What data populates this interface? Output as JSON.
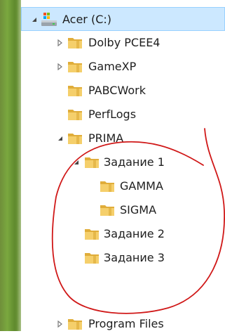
{
  "tree": {
    "drive": {
      "label": "Acer (C:)",
      "icon": "drive-icon",
      "expanded": true,
      "selected": true
    },
    "items": [
      {
        "label": "Dolby PCEE4",
        "icon": "folder-icon",
        "expander": "collapsed"
      },
      {
        "label": "GameXP",
        "icon": "folder-icon",
        "expander": "collapsed"
      },
      {
        "label": "PABCWork",
        "icon": "folder-icon",
        "expander": "none"
      },
      {
        "label": "PerfLogs",
        "icon": "folder-icon",
        "expander": "none"
      },
      {
        "label": "PRIMA",
        "icon": "folder-icon",
        "expander": "expanded"
      },
      {
        "label": "Задание 1",
        "icon": "folder-icon",
        "expander": "expanded"
      },
      {
        "label": "GAMMA",
        "icon": "folder-icon",
        "expander": "none"
      },
      {
        "label": "SIGMA",
        "icon": "folder-icon",
        "expander": "none"
      },
      {
        "label": "Задание 2",
        "icon": "folder-icon",
        "expander": "none"
      },
      {
        "label": "Задание 3",
        "icon": "folder-icon",
        "expander": "none"
      },
      {
        "label": "Program Files",
        "icon": "folder-icon",
        "expander": "collapsed"
      }
    ]
  },
  "colors": {
    "selection_bg": "#cce8ff",
    "folder": "#f1c75a",
    "annotation": "#d01818"
  }
}
